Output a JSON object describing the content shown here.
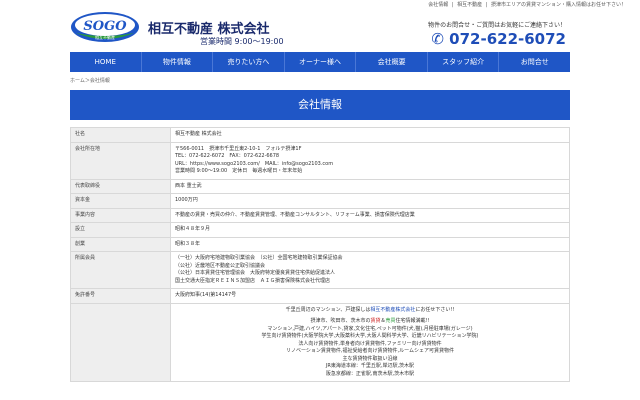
{
  "topbar": {
    "links": [
      "会社情報",
      "相互不動産",
      "摂津市エリアの賃貸マンション・購入情報はお任せ下さい！"
    ]
  },
  "header": {
    "logo_text": "SOGO",
    "logo_subtext": "相互不動産",
    "company_name": "相互不動産 株式会社",
    "hours": "営業時間 9:00〜19:00",
    "contact_label": "物件のお問合せ・ご質問はお気軽にご連絡下さい！",
    "phone": "072-622-6072"
  },
  "nav": {
    "items": [
      "HOME",
      "物件情報",
      "売りたい方へ",
      "オーナー様へ",
      "会社概要",
      "スタッフ紹介",
      "お問合せ"
    ]
  },
  "breadcrumb": "ホーム＞会社情報",
  "page_title": "会社情報",
  "rows": [
    {
      "label": "社名",
      "lines": [
        "相互不動産 株式会社"
      ]
    },
    {
      "label": "会社所在地",
      "lines": [
        "〒566-0011　摂津市千里丘東2-10-1　フォルテ摂津1F",
        "TEL：072-622-6072　FAX：072-622-6678",
        "URL：https://www.sogo2103.com/　MAIL：info@sogo2103.com",
        "営業時間 9:00〜19:00　定休日　毎週水曜日・年末年始"
      ]
    },
    {
      "label": "代表取締役",
      "lines": [
        "西本 重士武"
      ]
    },
    {
      "label": "資本金",
      "lines": [
        "1000万円"
      ]
    },
    {
      "label": "事業内容",
      "lines": [
        "不動産の賃貸・売買の仲介、不動産賃貸管理、不動産コンサルタント、リフォーム事業、損害保険代理店業"
      ]
    },
    {
      "label": "設立",
      "lines": [
        "昭和４８年９月"
      ]
    },
    {
      "label": "創業",
      "lines": [
        "昭和３８年"
      ]
    },
    {
      "label": "所属会員",
      "lines": [
        "（一社）大阪府宅地建物取引業協会　（公社）全国宅地建物取引業保証協会",
        "（公社）近畿地区不動産公正取引協議会",
        "（公社）日本賃貸住宅管理協会　大阪府特定優良賃貸住宅供給促進法人",
        "国土交通大臣指定ＲＥＩＮＳ加盟店　ＡＩＧ損害保険株式会社代理店"
      ]
    },
    {
      "label": "免許番号",
      "lines": [
        "大阪府知事(14)第14147号"
      ]
    }
  ],
  "promo": {
    "line1_pre": "千里丘周辺のマンション、戸建探しは",
    "line1_link": "相互不動産株式会社",
    "line1_post": "にお任せ下さい!!",
    "line2_pre": "摂津市、吹田市、茨木市の",
    "line2_red": "賃貸",
    "line2_mid": "＆",
    "line2_green": "売買",
    "line2_post": "住宅情報満載!!",
    "lines": [
      "マンション,戸建,ハイツ,アパート,貸家,文化住宅,ペット可物件(犬,猫),月極駐車場(ガレージ)",
      "学生向け賃貸物件(大阪学院大学,大阪薬科大学,大阪人間科学大学、近畿リハビリテーション学院)",
      "法人向け賃貸物件,単身者向け賃貸物件,ファミリー向け賃貸物件",
      "リノベーション賃貸物件,福祉受給者向け賃貸物件,ルームシェア可賃貸物件",
      "主な賃貸物件取扱い沿線",
      "JR東海道本線：千里丘駅,岸辺駅,茨木駅",
      "阪急京都線：正雀駅,南茨木駅,茨木市駅"
    ]
  }
}
